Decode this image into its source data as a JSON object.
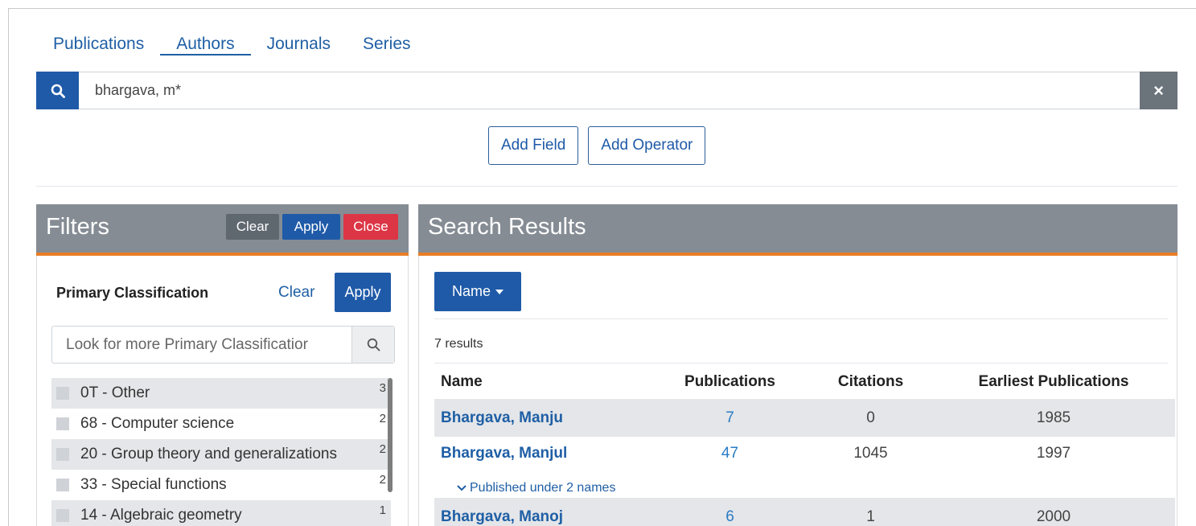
{
  "tabs": [
    "Publications",
    "Authors",
    "Journals",
    "Series"
  ],
  "search": {
    "value": "bhargava, m*",
    "clear_icon": "×"
  },
  "actions": {
    "add_field": "Add Field",
    "add_operator": "Add Operator"
  },
  "filters": {
    "title": "Filters",
    "clear": "Clear",
    "apply": "Apply",
    "close": "Close",
    "primary": {
      "title": "Primary Classification",
      "clear": "Clear",
      "apply": "Apply",
      "placeholder": "Look for more Primary Classificatior",
      "items": [
        {
          "label": "0T - Other",
          "count": "3"
        },
        {
          "label": "68 - Computer science",
          "count": "2"
        },
        {
          "label": "20 - Group theory and generalizations",
          "count": "2"
        },
        {
          "label": "33 - Special functions",
          "count": "2"
        },
        {
          "label": "14 - Algebraic geometry",
          "count": "1"
        }
      ]
    }
  },
  "results": {
    "title": "Search Results",
    "sort_label": "Name",
    "count": "7 results",
    "columns": [
      "Name",
      "Publications",
      "Citations",
      "Earliest Publications"
    ],
    "rows": [
      {
        "name": "Bhargava, Manju",
        "publications": "7",
        "citations": "0",
        "earliest": "1985"
      },
      {
        "name": "Bhargava, Manjul",
        "publications": "47",
        "citations": "1045",
        "earliest": "1997",
        "note": "Published under 2 names"
      },
      {
        "name": "Bhargava, Manoj",
        "publications": "6",
        "citations": "1",
        "earliest": "2000"
      }
    ]
  },
  "colors": {
    "primary": "#1f5aa8",
    "header_gray": "#858c94",
    "accent_orange": "#e97d26",
    "close_red": "#dc3545"
  }
}
